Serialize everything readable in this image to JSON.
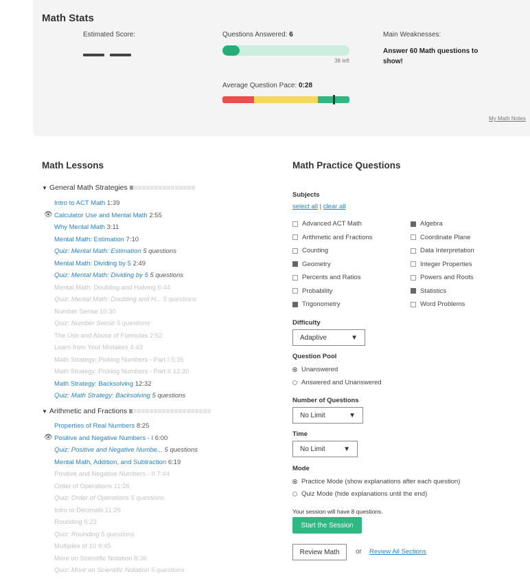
{
  "stats": {
    "title": "Math Stats",
    "estimated_label": "Estimated Score:",
    "questions_answered_label": "Questions Answered:",
    "questions_answered_value": "6",
    "questions_progress": 0.136,
    "questions_left": "38 left",
    "pace_label": "Average Question Pace:",
    "pace_value": "0:28",
    "pace_marker_fraction": 0.87,
    "pace_colors": [
      "#ee4d4d",
      "#f5d858",
      "#2fb881"
    ],
    "weakness_label": "Main Weaknesses:",
    "weakness_text": "Answer 60 Math questions to show!",
    "notes_link": "My Math Notes"
  },
  "lessons": {
    "title": "Math Lessons",
    "groups": [
      {
        "name": "General Math Strategies",
        "progress_dots": 1,
        "total_dots": 16
      },
      {
        "name": "Arithmetic and Fractions",
        "progress_dots": 1,
        "total_dots": 20
      }
    ],
    "items": [
      {
        "title": "Intro to ACT Math",
        "meta": "1:39",
        "state": "active",
        "quiz": false,
        "eye": false
      },
      {
        "title": "Calculator Use and Mental Math",
        "meta": "2:55",
        "state": "active",
        "quiz": false,
        "eye": true
      },
      {
        "title": "Why Mental Math",
        "meta": "3:11",
        "state": "active",
        "quiz": false,
        "eye": false
      },
      {
        "title": "Mental Math: Estimation",
        "meta": "7:10",
        "state": "active",
        "quiz": false,
        "eye": false
      },
      {
        "title": "Quiz: Mental Math: Estimation",
        "meta": "5 questions",
        "state": "active",
        "quiz": true,
        "eye": false
      },
      {
        "title": "Mental Math: Dividing by 5",
        "meta": "2:49",
        "state": "active",
        "quiz": false,
        "eye": false
      },
      {
        "title": "Quiz: Mental Math: Dividing by 5",
        "meta": "5 questions",
        "state": "active",
        "quiz": true,
        "eye": false
      },
      {
        "title": "Mental Math: Doubling and Halving",
        "meta": "6:44",
        "state": "dim",
        "quiz": false,
        "eye": false
      },
      {
        "title": "Quiz: Mental Math: Doubling and H...",
        "meta": "5 questions",
        "state": "dim",
        "quiz": true,
        "eye": false
      },
      {
        "title": "Number Sense",
        "meta": "10:30",
        "state": "dim",
        "quiz": false,
        "eye": false
      },
      {
        "title": "Quiz: Number Sense",
        "meta": "5 questions",
        "state": "dim",
        "quiz": true,
        "eye": false
      },
      {
        "title": "The Use and Abuse of Formulas",
        "meta": "2:52",
        "state": "dim",
        "quiz": false,
        "eye": false
      },
      {
        "title": "Learn from Your Mistakes",
        "meta": "4:43",
        "state": "dim",
        "quiz": false,
        "eye": false
      },
      {
        "title": "Math Strategy: Picking Numbers - Part I",
        "meta": "5:35",
        "state": "dim",
        "quiz": false,
        "eye": false
      },
      {
        "title": "Math Strategy: Picking Numbers - Part II",
        "meta": "12:30",
        "state": "dim",
        "quiz": false,
        "eye": false
      },
      {
        "title": "Math Strategy: Backsolving",
        "meta": "12:32",
        "state": "active",
        "quiz": false,
        "eye": false
      },
      {
        "title": "Quiz: Math Strategy: Backsolving",
        "meta": "5 questions",
        "state": "active",
        "quiz": true,
        "eye": false
      },
      {
        "title": "Properties of Real Numbers",
        "meta": "8:25",
        "state": "active",
        "quiz": false,
        "eye": false
      },
      {
        "title": "Positive and Negative Numbers - I",
        "meta": "6:00",
        "state": "active",
        "quiz": false,
        "eye": true
      },
      {
        "title": "Quiz: Positive and Negative Numbe...",
        "meta": "5 questions",
        "state": "active",
        "quiz": true,
        "eye": false
      },
      {
        "title": "Mental Math, Addition, and Subtraction",
        "meta": "6:19",
        "state": "active",
        "quiz": false,
        "eye": false
      },
      {
        "title": "Positive and Negative Numbers - II",
        "meta": "7:44",
        "state": "dim",
        "quiz": false,
        "eye": false
      },
      {
        "title": "Order of Operations",
        "meta": "11:26",
        "state": "dim",
        "quiz": false,
        "eye": false
      },
      {
        "title": "Quiz: Order of Operations",
        "meta": "5 questions",
        "state": "dim",
        "quiz": true,
        "eye": false
      },
      {
        "title": "Intro to Decimals",
        "meta": "11:26",
        "state": "dim",
        "quiz": false,
        "eye": false
      },
      {
        "title": "Rounding",
        "meta": "6:23",
        "state": "dim",
        "quiz": false,
        "eye": false
      },
      {
        "title": "Quiz: Rounding",
        "meta": "5 questions",
        "state": "dim",
        "quiz": true,
        "eye": false
      },
      {
        "title": "Multiples of 10",
        "meta": "9:45",
        "state": "dim",
        "quiz": false,
        "eye": false
      },
      {
        "title": "More on Scientific Notation",
        "meta": "8:36",
        "state": "dim",
        "quiz": false,
        "eye": false
      },
      {
        "title": "Quiz: More on Scientific Notation",
        "meta": "5 questions",
        "state": "dim",
        "quiz": true,
        "eye": false
      }
    ]
  },
  "practice": {
    "title": "Math Practice Questions",
    "subjects_label": "Subjects",
    "select_all": "select all",
    "separator": "|",
    "clear_all": "clear all",
    "subjects": [
      {
        "name": "Advanced ACT Math",
        "checked": false
      },
      {
        "name": "Algebra",
        "checked": true
      },
      {
        "name": "Arithmetic and Fractions",
        "checked": false
      },
      {
        "name": "Coordinate Plane",
        "checked": false
      },
      {
        "name": "Counting",
        "checked": false
      },
      {
        "name": "Data Interpretation",
        "checked": false
      },
      {
        "name": "Geometry",
        "checked": true
      },
      {
        "name": "Integer Properties",
        "checked": false
      },
      {
        "name": "Percents and Ratios",
        "checked": false
      },
      {
        "name": "Powers and Roots",
        "checked": false
      },
      {
        "name": "Probability",
        "checked": false
      },
      {
        "name": "Statistics",
        "checked": true
      },
      {
        "name": "Trigonometry",
        "checked": true
      },
      {
        "name": "Word Problems",
        "checked": false
      }
    ],
    "difficulty_label": "Difficulty",
    "difficulty_value": "Adaptive",
    "pool_label": "Question Pool",
    "pool_options": [
      {
        "label": "Unanswered",
        "selected": true
      },
      {
        "label": "Answered and Unanswered",
        "selected": false
      }
    ],
    "num_label": "Number of Questions",
    "num_value": "No Limit",
    "time_label": "Time",
    "time_value": "No Limit",
    "mode_label": "Mode",
    "mode_options": [
      {
        "label": "Practice Mode (show explanations after each question)",
        "selected": true
      },
      {
        "label": "Quiz Mode (hide explanations until the end)",
        "selected": false
      }
    ],
    "session_note": "Your session will have 8 questions.",
    "start_button": "Start the Session",
    "review_button": "Review Math",
    "or_text": "or",
    "review_all_link": "Review All Sections",
    "dropdown_arrow": "▼"
  },
  "colors": {
    "link": "#2a82c8",
    "green": "#2fb881",
    "progress_track": "#cceee0"
  }
}
